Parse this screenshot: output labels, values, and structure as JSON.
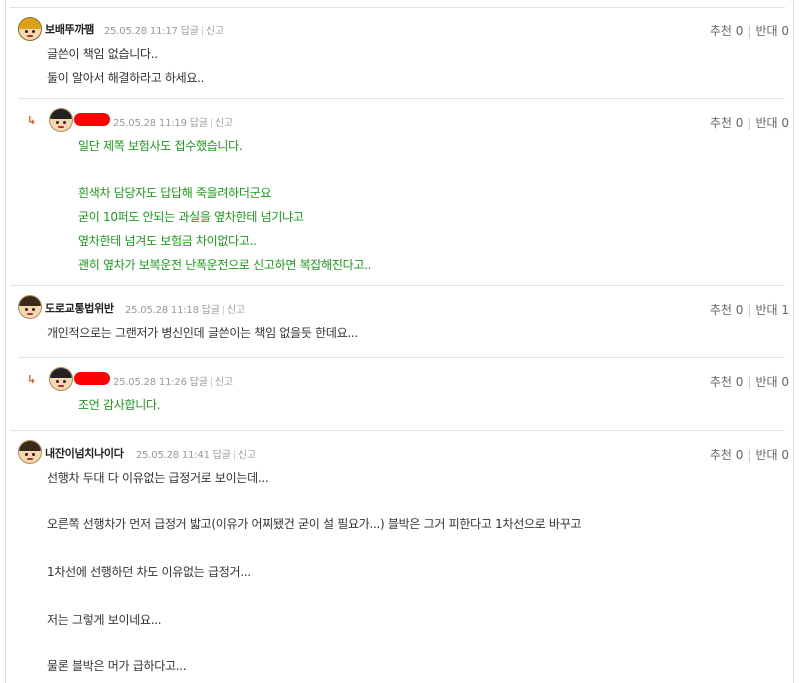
{
  "actions": {
    "reply": "답글",
    "report": "신고"
  },
  "comments": [
    {
      "nick": "보배뚜까팸",
      "time": "25.05.28 11:17",
      "up": "추천 0",
      "down": "반대 0",
      "lines": [
        "글쓴이 책임 없습니다..",
        "둘이 알아서 해결하라고 하세요.."
      ]
    },
    {
      "nick": "",
      "time": "25.05.28 11:19",
      "up": "추천 0",
      "down": "반대 0",
      "lines": [
        "일단 제쪽 보험사도 접수했습니다.",
        "흰색차 담당자도 답답해 죽을려하더군요",
        "굳이 10퍼도 안되는 과실을 옆차한테 넘기냐고",
        "옆차한테 넘겨도 보험금 차이없다고..",
        "괜히 옆차가 보복운전 난폭운전으로 신고하면 복잡해진다고.."
      ]
    },
    {
      "nick": "도로교통법위반",
      "time": "25.05.28 11:18",
      "up": "추천 0",
      "down": "반대 1",
      "lines": [
        "개인적으로는 그랜저가 병신인데 글쓴이는 책임 없을듯 한데요..."
      ]
    },
    {
      "nick": "",
      "time": "25.05.28 11:26",
      "up": "추천 0",
      "down": "반대 0",
      "lines": [
        "조언 감사합니다."
      ]
    },
    {
      "nick": "내잔이넘치나이다",
      "time": "25.05.28 11:41",
      "up": "추천 0",
      "down": "반대 0",
      "lines": [
        "선행차 두대 다 이유없는 급정거로 보이는데...",
        "오른쪽 선행차가 먼저 급정거 밟고(이유가 어찌됐건 굳이 설 필요가...) 블박은 그거 피한다고 1차선으로 바꾸고",
        "1차선에 선행하던 차도 이유없는 급정거...",
        "저는 그렇게 보이네요...",
        "물론 블박은 머가 급하다고..."
      ]
    }
  ]
}
